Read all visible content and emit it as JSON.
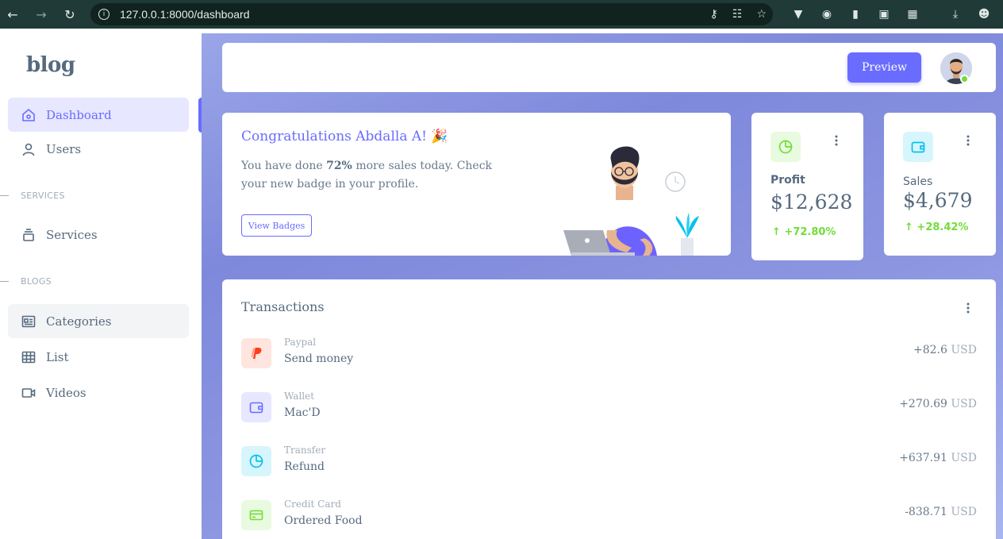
{
  "browser": {
    "url": "127.0.0.1:8000/dashboard"
  },
  "sidebar": {
    "logo": "blog",
    "items": [
      {
        "label": "Dashboard",
        "icon": "home-icon"
      },
      {
        "label": "Users",
        "icon": "user-icon"
      },
      {
        "label": "Services",
        "icon": "stack-icon"
      },
      {
        "label": "Categories",
        "icon": "news-icon"
      },
      {
        "label": "List",
        "icon": "table-icon"
      },
      {
        "label": "Videos",
        "icon": "video-icon"
      }
    ],
    "sections": [
      "SERVICES",
      "BLOGS"
    ]
  },
  "topbar": {
    "preview_label": "Preview"
  },
  "welcome": {
    "title": "Congratulations Abdalla A! 🎉",
    "text_before": "You have done ",
    "text_bold": "72%",
    "text_after": " more sales today. Check your new badge in your profile.",
    "button": "View Badges"
  },
  "stats": [
    {
      "label": "Profit",
      "value": "$12,628",
      "change": "+72.80%",
      "color": "#71dd37"
    },
    {
      "label": "Sales",
      "value": "$4,679",
      "change": "+28.42%",
      "color": "#03c3ec"
    }
  ],
  "transactions": {
    "title": "Transactions",
    "rows": [
      {
        "category": "Paypal",
        "name": "Send money",
        "amount": "+82.6",
        "currency": "USD",
        "icon": "paypal-icon",
        "color": "#ff3e1d"
      },
      {
        "category": "Wallet",
        "name": "Mac'D",
        "amount": "+270.69",
        "currency": "USD",
        "icon": "wallet-icon",
        "color": "#696cff"
      },
      {
        "category": "Transfer",
        "name": "Refund",
        "amount": "+637.91",
        "currency": "USD",
        "icon": "pie-chart-icon",
        "color": "#03c3ec"
      },
      {
        "category": "Credit Card",
        "name": "Ordered Food",
        "amount": "-838.71",
        "currency": "USD",
        "icon": "credit-card-icon",
        "color": "#71dd37"
      }
    ]
  }
}
